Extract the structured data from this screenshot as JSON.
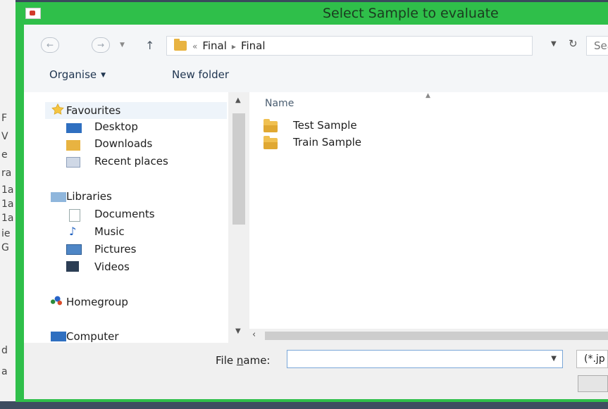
{
  "background_strip": [
    "F",
    "V",
    "e",
    "ra",
    "1a",
    "1a",
    "1a",
    "ie",
    "G",
    "d",
    "a"
  ],
  "dialog": {
    "title": "Select Sample to evaluate",
    "accent_color": "#2fbf4a"
  },
  "nav": {
    "back_icon": "back-arrow-icon",
    "forward_icon": "forward-arrow-icon",
    "up_icon": "up-arrow-icon",
    "refresh_icon": "refresh-icon"
  },
  "address": {
    "overflow": "«",
    "crumbs": [
      "Final",
      "Final"
    ],
    "separator": "▸"
  },
  "search": {
    "placeholder": "Searc"
  },
  "toolbar": {
    "organise_label": "Organise",
    "new_folder_label": "New folder"
  },
  "navpane": {
    "favourites": "Favourites",
    "desktop": "Desktop",
    "downloads": "Downloads",
    "recent_places": "Recent places",
    "libraries": "Libraries",
    "documents": "Documents",
    "music": "Music",
    "pictures": "Pictures",
    "videos": "Videos",
    "homegroup": "Homegroup",
    "computer": "Computer"
  },
  "filelist": {
    "column_name": "Name",
    "items": [
      "Test Sample",
      "Train Sample"
    ]
  },
  "bottom": {
    "file_name_label_prefix": "File ",
    "file_name_label_underlined": "n",
    "file_name_label_suffix": "ame:",
    "file_name_value": "",
    "filter_value": "(*.jp"
  }
}
